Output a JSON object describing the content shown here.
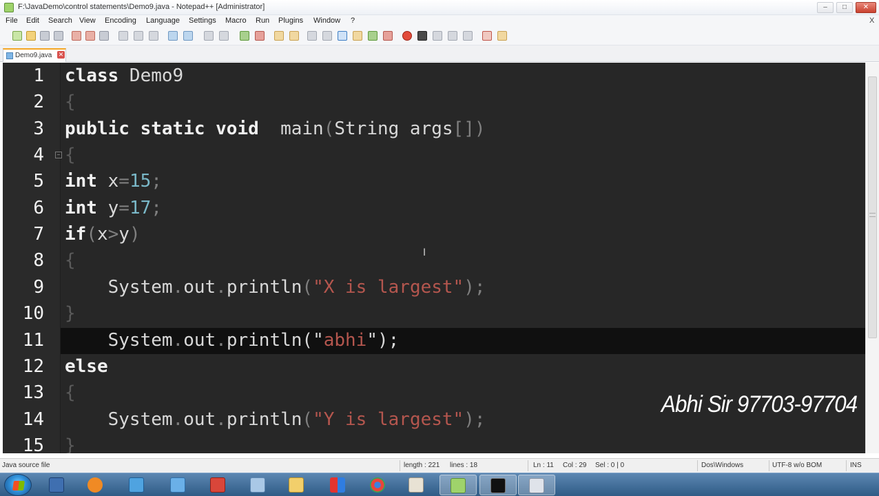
{
  "window": {
    "title": "F:\\JavaDemo\\control statements\\Demo9.java - Notepad++ [Administrator]",
    "controls": {
      "minimize": "–",
      "maximize": "□",
      "close": "✕"
    }
  },
  "menu": {
    "items": [
      "File",
      "Edit",
      "Search",
      "View",
      "Encoding",
      "Language",
      "Settings",
      "Macro",
      "Run",
      "Plugins",
      "Window",
      "?"
    ],
    "close_doc": "X"
  },
  "tabs": [
    {
      "label": "Demo9.java",
      "active": true
    }
  ],
  "editor": {
    "line_numbers": [
      "1",
      "2",
      "3",
      "4",
      "5",
      "6",
      "7",
      "8",
      "9",
      "10",
      "11",
      "12",
      "13",
      "14",
      "15"
    ],
    "lines": {
      "l1_kw": "class",
      "l1_name": " Demo9",
      "l2_brace": "{",
      "l3_kw1": "public",
      "l3_kw2": " static",
      "l3_kw3": " void",
      "l3_rest": "  main",
      "l3_p1": "(",
      "l3_args": "String args",
      "l3_p2": "[])",
      "l4_brace": "{",
      "l5_kw": "int",
      "l5_var": " x",
      "l5_eq": "=",
      "l5_num": "15",
      "l5_semi": ";",
      "l6_kw": "int",
      "l6_var": " y",
      "l6_eq": "=",
      "l6_num": "17",
      "l6_semi": ";",
      "l7_kw": "if",
      "l7_p1": "(",
      "l7_x": "x",
      "l7_op": ">",
      "l7_y": "y",
      "l7_p2": ")",
      "l8_brace": "{",
      "l9_indent": "    ",
      "l9_obj": "System",
      "l9_d1": ".",
      "l9_out": "out",
      "l9_d2": ".",
      "l9_fn": "println",
      "l9_p1": "(",
      "l9_str": "\"X is largest\"",
      "l9_p2": ");",
      "l10_brace": "}",
      "l11_indent": "    ",
      "l11_obj": "System",
      "l11_d1": ".",
      "l11_out": "out",
      "l11_d2": ".",
      "l11_fn": "println",
      "l11_p1": "(",
      "l11_q1": "\"",
      "l11_str": "abhi",
      "l11_q2": "\"",
      "l11_p2": ");",
      "l12_kw": "else",
      "l13_brace": "{",
      "l14_indent": "    ",
      "l14_obj": "System",
      "l14_d1": ".",
      "l14_out": "out",
      "l14_d2": ".",
      "l14_fn": "println",
      "l14_p1": "(",
      "l14_str": "\"Y is largest\"",
      "l14_p2": ");",
      "l15_brace": "}"
    },
    "caret_glyph": "I"
  },
  "watermark": "Abhi Sir 97703-97704",
  "status": {
    "file_type": "Java source file",
    "length": "length : 221",
    "lines": "lines : 18",
    "ln": "Ln : 11",
    "col": "Col : 29",
    "sel": "Sel : 0 | 0",
    "eol": "Dos\\Windows",
    "encoding": "UTF-8 w/o BOM",
    "mode": "INS"
  },
  "colors": {
    "editor_bg": "#272727",
    "current_line_bg": "#101010",
    "string": "#b4564e",
    "number": "#7ab8c8",
    "taskbar": "#2f5b86"
  }
}
